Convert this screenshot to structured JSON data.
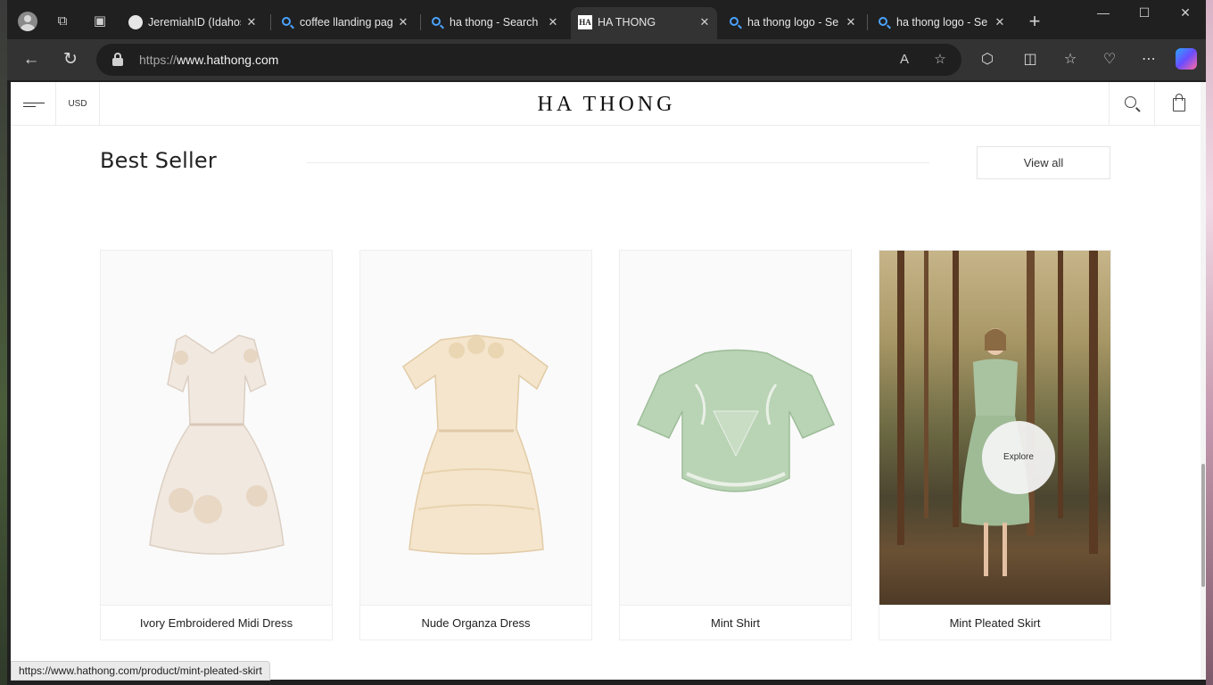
{
  "browser": {
    "tabs": [
      {
        "title": "JeremiahID (Idahos",
        "icon": "github-icon",
        "active": false
      },
      {
        "title": "coffee llanding pag",
        "icon": "search-icon",
        "active": false
      },
      {
        "title": "ha thong - Search",
        "icon": "search-icon",
        "active": false
      },
      {
        "title": "HA THONG",
        "icon": "site-favicon",
        "active": true
      },
      {
        "title": "ha thong logo - Se",
        "icon": "search-icon",
        "active": false
      },
      {
        "title": "ha thong logo - Se",
        "icon": "search-icon",
        "active": false
      }
    ],
    "url_scheme": "https://",
    "url_host": "www.hathong.com",
    "status_url": "https://www.hathong.com/product/mint-pleated-skirt"
  },
  "site": {
    "currency": "USD",
    "logo": "HA THONG"
  },
  "section": {
    "title": "Best Seller",
    "view_all": "View all",
    "explore_label": "Explore"
  },
  "products": [
    {
      "name": "Ivory Embroidered Midi Dress",
      "color": "#f1e8e0"
    },
    {
      "name": "Nude Organza Dress",
      "color": "#f3e2c6"
    },
    {
      "name": "Mint Shirt",
      "color": "#b9d3b5"
    },
    {
      "name": "Mint Pleated Skirt",
      "color": "#a9c3a0"
    }
  ]
}
